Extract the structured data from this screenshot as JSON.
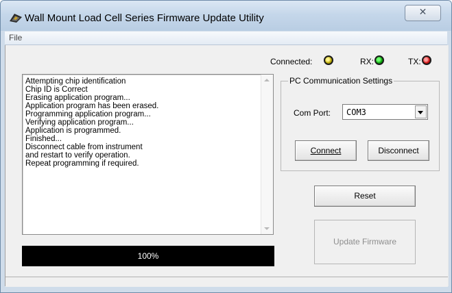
{
  "window": {
    "title": "Wall Mount Load Cell Series Firmware Update Utility",
    "close_symbol": "✕"
  },
  "menu": {
    "items": [
      "File"
    ]
  },
  "status": {
    "connected_label": "Connected:",
    "rx_label": "RX:",
    "tx_label": "TX:",
    "connected_color": "#c8b400",
    "rx_color": "#1bb21b",
    "tx_color": "#d11a1a"
  },
  "log": {
    "lines": [
      "Attempting chip identification",
      "Chip ID is Correct",
      "Erasing application program...",
      "Application program has been erased.",
      "Programming application program...",
      "Verifying application program...",
      "Application is programmed.",
      "Finished...",
      "Disconnect cable from instrument",
      "and restart to verify operation.",
      "Repeat programming if required."
    ]
  },
  "progress": {
    "percent": 100,
    "label": "100%"
  },
  "pc_settings": {
    "group_title": "PC Communication Settings",
    "com_port_label": "Com Port:",
    "com_port_value": "COM3",
    "connect_label": "Connect",
    "disconnect_label": "Disconnect"
  },
  "actions": {
    "reset_label": "Reset",
    "update_label": "Update Firmware"
  }
}
